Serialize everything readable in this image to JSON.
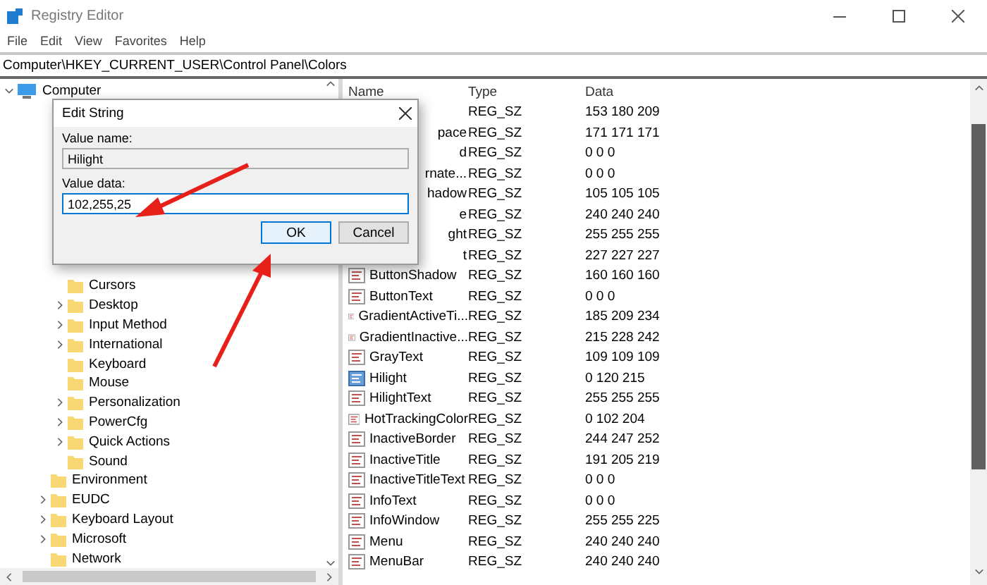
{
  "window": {
    "title": "Registry Editor"
  },
  "menu": [
    "File",
    "Edit",
    "View",
    "Favorites",
    "Help"
  ],
  "address": "Computer\\HKEY_CURRENT_USER\\Control Panel\\Colors",
  "tree": {
    "label": "Computer",
    "expanded": true,
    "children": [
      {
        "kind": "covered"
      },
      {
        "kind": "covered",
        "children": [
          {
            "kind": "covered"
          },
          {
            "kind": "covered"
          },
          {
            "kind": "covered",
            "children": [
              {
                "kind": "covered"
              },
              {
                "kind": "covered"
              },
              {
                "kind": "covered"
              },
              {
                "kind": "covered"
              },
              {
                "kind": "folder",
                "label": "Cursors"
              },
              {
                "kind": "folder",
                "label": "Desktop",
                "expanded": false
              },
              {
                "kind": "folder",
                "label": "Input Method",
                "expanded": false
              },
              {
                "kind": "folder",
                "label": "International",
                "expanded": false
              },
              {
                "kind": "folder",
                "label": "Keyboard"
              },
              {
                "kind": "folder",
                "label": "Mouse"
              },
              {
                "kind": "folder",
                "label": "Personalization",
                "expanded": false
              },
              {
                "kind": "folder",
                "label": "PowerCfg",
                "expanded": false
              },
              {
                "kind": "folder",
                "label": "Quick Actions",
                "expanded": false
              },
              {
                "kind": "folder",
                "label": "Sound"
              }
            ]
          },
          {
            "kind": "folder",
            "label": "Environment"
          },
          {
            "kind": "folder",
            "label": "EUDC",
            "expanded": false
          },
          {
            "kind": "folder",
            "label": "Keyboard Layout",
            "expanded": false
          },
          {
            "kind": "folder",
            "label": "Microsoft",
            "expanded": false
          },
          {
            "kind": "folder",
            "label": "Network"
          }
        ]
      }
    ]
  },
  "columns": [
    "Name",
    "Type",
    "Data"
  ],
  "rows": [
    {
      "kind": "covered",
      "type": "REG_SZ",
      "data": "153 180 209"
    },
    {
      "kind": "covered",
      "name": "pace",
      "type": "REG_SZ",
      "data": "171 171 171"
    },
    {
      "kind": "covered",
      "name": "d",
      "type": "REG_SZ",
      "data": "0 0 0"
    },
    {
      "kind": "covered",
      "name": "rnate...",
      "type": "REG_SZ",
      "data": "0 0 0"
    },
    {
      "kind": "covered",
      "name": "hadow",
      "type": "REG_SZ",
      "data": "105 105 105"
    },
    {
      "kind": "covered",
      "name": "e",
      "type": "REG_SZ",
      "data": "240 240 240"
    },
    {
      "kind": "covered",
      "name": "ght",
      "type": "REG_SZ",
      "data": "255 255 255"
    },
    {
      "kind": "covered",
      "name": "t",
      "type": "REG_SZ",
      "data": "227 227 227"
    },
    {
      "kind": "value",
      "name": "ButtonShadow",
      "type": "REG_SZ",
      "data": "160 160 160",
      "selected": false
    },
    {
      "kind": "value",
      "name": "ButtonText",
      "type": "REG_SZ",
      "data": "0 0 0",
      "selected": false
    },
    {
      "kind": "value",
      "name": "GradientActiveTi...",
      "type": "REG_SZ",
      "data": "185 209 234",
      "selected": false
    },
    {
      "kind": "value",
      "name": "GradientInactive...",
      "type": "REG_SZ",
      "data": "215 228 242",
      "selected": false
    },
    {
      "kind": "value",
      "name": "GrayText",
      "type": "REG_SZ",
      "data": "109 109 109",
      "selected": false
    },
    {
      "kind": "value",
      "name": "Hilight",
      "type": "REG_SZ",
      "data": "0 120 215",
      "selected": true
    },
    {
      "kind": "value",
      "name": "HilightText",
      "type": "REG_SZ",
      "data": "255 255 255",
      "selected": false
    },
    {
      "kind": "value",
      "name": "HotTrackingColor",
      "type": "REG_SZ",
      "data": "0 102 204",
      "selected": false
    },
    {
      "kind": "value",
      "name": "InactiveBorder",
      "type": "REG_SZ",
      "data": "244 247 252",
      "selected": false
    },
    {
      "kind": "value",
      "name": "InactiveTitle",
      "type": "REG_SZ",
      "data": "191 205 219",
      "selected": false
    },
    {
      "kind": "value",
      "name": "InactiveTitleText",
      "type": "REG_SZ",
      "data": "0 0 0",
      "selected": false
    },
    {
      "kind": "value",
      "name": "InfoText",
      "type": "REG_SZ",
      "data": "0 0 0",
      "selected": false
    },
    {
      "kind": "value",
      "name": "InfoWindow",
      "type": "REG_SZ",
      "data": "255 255 225",
      "selected": false
    },
    {
      "kind": "value",
      "name": "Menu",
      "type": "REG_SZ",
      "data": "240 240 240",
      "selected": false
    },
    {
      "kind": "value",
      "name": "MenuBar",
      "type": "REG_SZ",
      "data": "240 240 240",
      "selected": false
    }
  ],
  "dialog": {
    "title": "Edit String",
    "value_name_label": "Value name:",
    "value_name": "Hilight",
    "value_data_label": "Value data:",
    "value_data": "102,255,25",
    "buttons": [
      {
        "label": "OK",
        "default": true
      },
      {
        "label": "Cancel",
        "default": false
      }
    ]
  }
}
